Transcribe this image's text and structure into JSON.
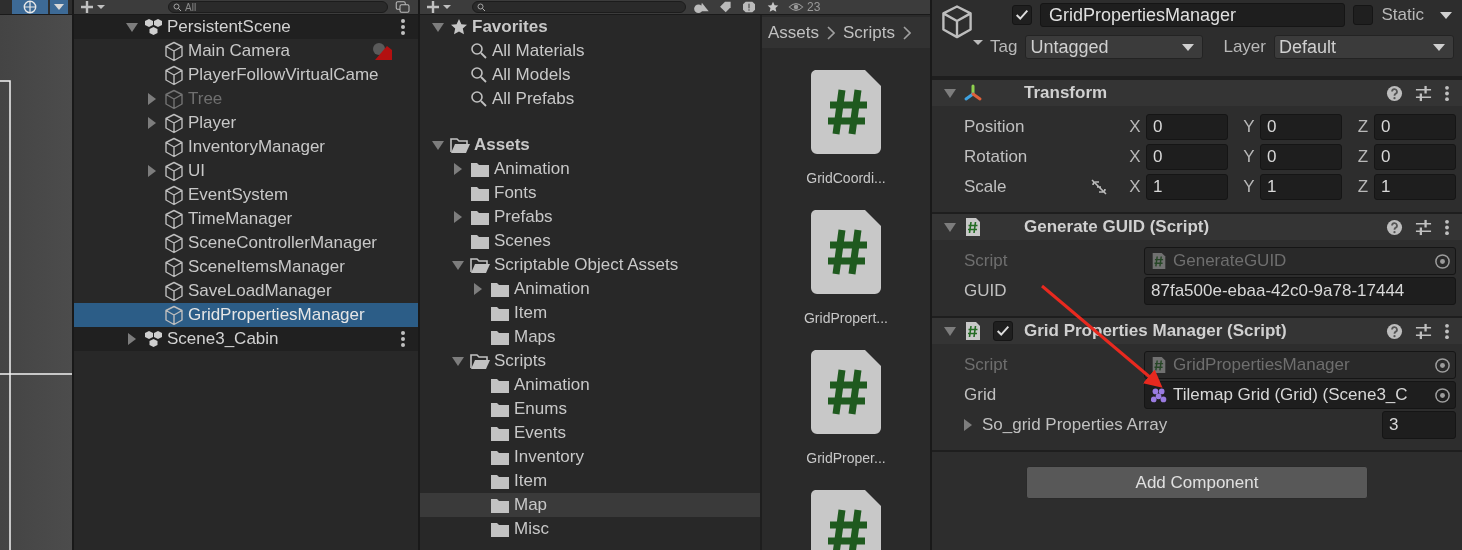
{
  "hierarchy": {
    "search": {
      "placeholder": "All"
    },
    "scenes": [
      {
        "name": "PersistentScene",
        "expanded": true,
        "children": [
          {
            "name": "Main Camera",
            "active": true,
            "selected": false,
            "warning": true
          },
          {
            "name": "PlayerFollowVirtualCame",
            "active": true,
            "selected": false,
            "warning": false
          },
          {
            "name": "Tree",
            "expanded": false,
            "active": false,
            "selected": false,
            "warning": false
          },
          {
            "name": "Player",
            "expanded": false,
            "active": true,
            "selected": false,
            "warning": false
          },
          {
            "name": "InventoryManager",
            "active": true,
            "selected": false,
            "warning": false
          },
          {
            "name": "UI",
            "expanded": false,
            "active": true,
            "selected": false,
            "warning": false
          },
          {
            "name": "EventSystem",
            "active": true,
            "selected": false,
            "warning": false
          },
          {
            "name": "TimeManager",
            "active": true,
            "selected": false,
            "warning": false
          },
          {
            "name": "SceneControllerManager",
            "active": true,
            "selected": false,
            "warning": false
          },
          {
            "name": "SceneItemsManager",
            "active": true,
            "selected": false,
            "warning": false
          },
          {
            "name": "SaveLoadManager",
            "active": true,
            "selected": false,
            "warning": false
          },
          {
            "name": "GridPropertiesManager",
            "active": true,
            "selected": true,
            "warning": false
          }
        ]
      },
      {
        "name": "Scene3_Cabin",
        "expanded": false
      }
    ]
  },
  "project": {
    "hidden_count": "23",
    "favorites": {
      "label": "Favorites",
      "expanded": true,
      "items": [
        "All Materials",
        "All Models",
        "All Prefabs"
      ]
    },
    "tree": [
      {
        "name": "Assets",
        "expanded": true,
        "selected": false,
        "children": [
          {
            "name": "Animation",
            "expanded": false,
            "selected": false
          },
          {
            "name": "Fonts",
            "selected": false
          },
          {
            "name": "Prefabs",
            "expanded": false,
            "selected": false
          },
          {
            "name": "Scenes",
            "selected": false
          },
          {
            "name": "Scriptable Object Assets",
            "expanded": true,
            "selected": false,
            "children": [
              {
                "name": "Animation",
                "expanded": false,
                "selected": false
              },
              {
                "name": "Item",
                "selected": false
              },
              {
                "name": "Maps",
                "selected": false
              }
            ]
          },
          {
            "name": "Scripts",
            "expanded": true,
            "selected": false,
            "children": [
              {
                "name": "Animation",
                "selected": false
              },
              {
                "name": "Enums",
                "selected": false
              },
              {
                "name": "Events",
                "selected": false
              },
              {
                "name": "Inventory",
                "selected": false
              },
              {
                "name": "Item",
                "selected": false
              },
              {
                "name": "Map",
                "selected": true
              },
              {
                "name": "Misc",
                "selected": false
              }
            ]
          }
        ]
      }
    ],
    "breadcrumb": [
      "Assets",
      "Scripts"
    ],
    "files": [
      {
        "kind": "script",
        "name": "GridCoordi..."
      },
      {
        "kind": "script",
        "name": "GridPropert..."
      },
      {
        "kind": "script",
        "name": "GridProper..."
      },
      {
        "kind": "script"
      }
    ]
  },
  "inspector": {
    "active": true,
    "name": "GridPropertiesManager",
    "static": false,
    "static_label": "Static",
    "tag_label": "Tag",
    "tag": "Untagged",
    "layer_label": "Layer",
    "layer": "Default",
    "components": [
      {
        "kind": "transform",
        "title": "Transform",
        "rows": [
          {
            "label": "Position",
            "link_icon": false,
            "values": [
              {
                "axis": "X",
                "value": "0"
              },
              {
                "axis": "Y",
                "value": "0"
              },
              {
                "axis": "Z",
                "value": "0"
              }
            ]
          },
          {
            "label": "Rotation",
            "link_icon": false,
            "values": [
              {
                "axis": "X",
                "value": "0"
              },
              {
                "axis": "Y",
                "value": "0"
              },
              {
                "axis": "Z",
                "value": "0"
              }
            ]
          },
          {
            "label": "Scale",
            "link_icon": true,
            "values": [
              {
                "axis": "X",
                "value": "1"
              },
              {
                "axis": "Y",
                "value": "1"
              },
              {
                "axis": "Z",
                "value": "1"
              }
            ]
          }
        ]
      },
      {
        "kind": "script",
        "title": "Generate GUID (Script)",
        "fields": [
          {
            "kind": "script",
            "label": "Script",
            "value": "GenerateGUID"
          },
          {
            "kind": "text",
            "label": "GUID",
            "value": "87fa500e-ebaa-42c0-9a78-17444"
          }
        ]
      },
      {
        "kind": "script",
        "title": "Grid Properties Manager (Script)",
        "enabled": true,
        "fields": [
          {
            "kind": "script",
            "label": "Script",
            "value": "GridPropertiesManager"
          },
          {
            "kind": "object",
            "label": "Grid",
            "value": "Tilemap Grid (Grid) (Scene3_C"
          },
          {
            "kind": "array",
            "label": "So_grid Properties Array",
            "value": "3",
            "expanded": false
          }
        ]
      }
    ],
    "add_button": "Add Component"
  }
}
